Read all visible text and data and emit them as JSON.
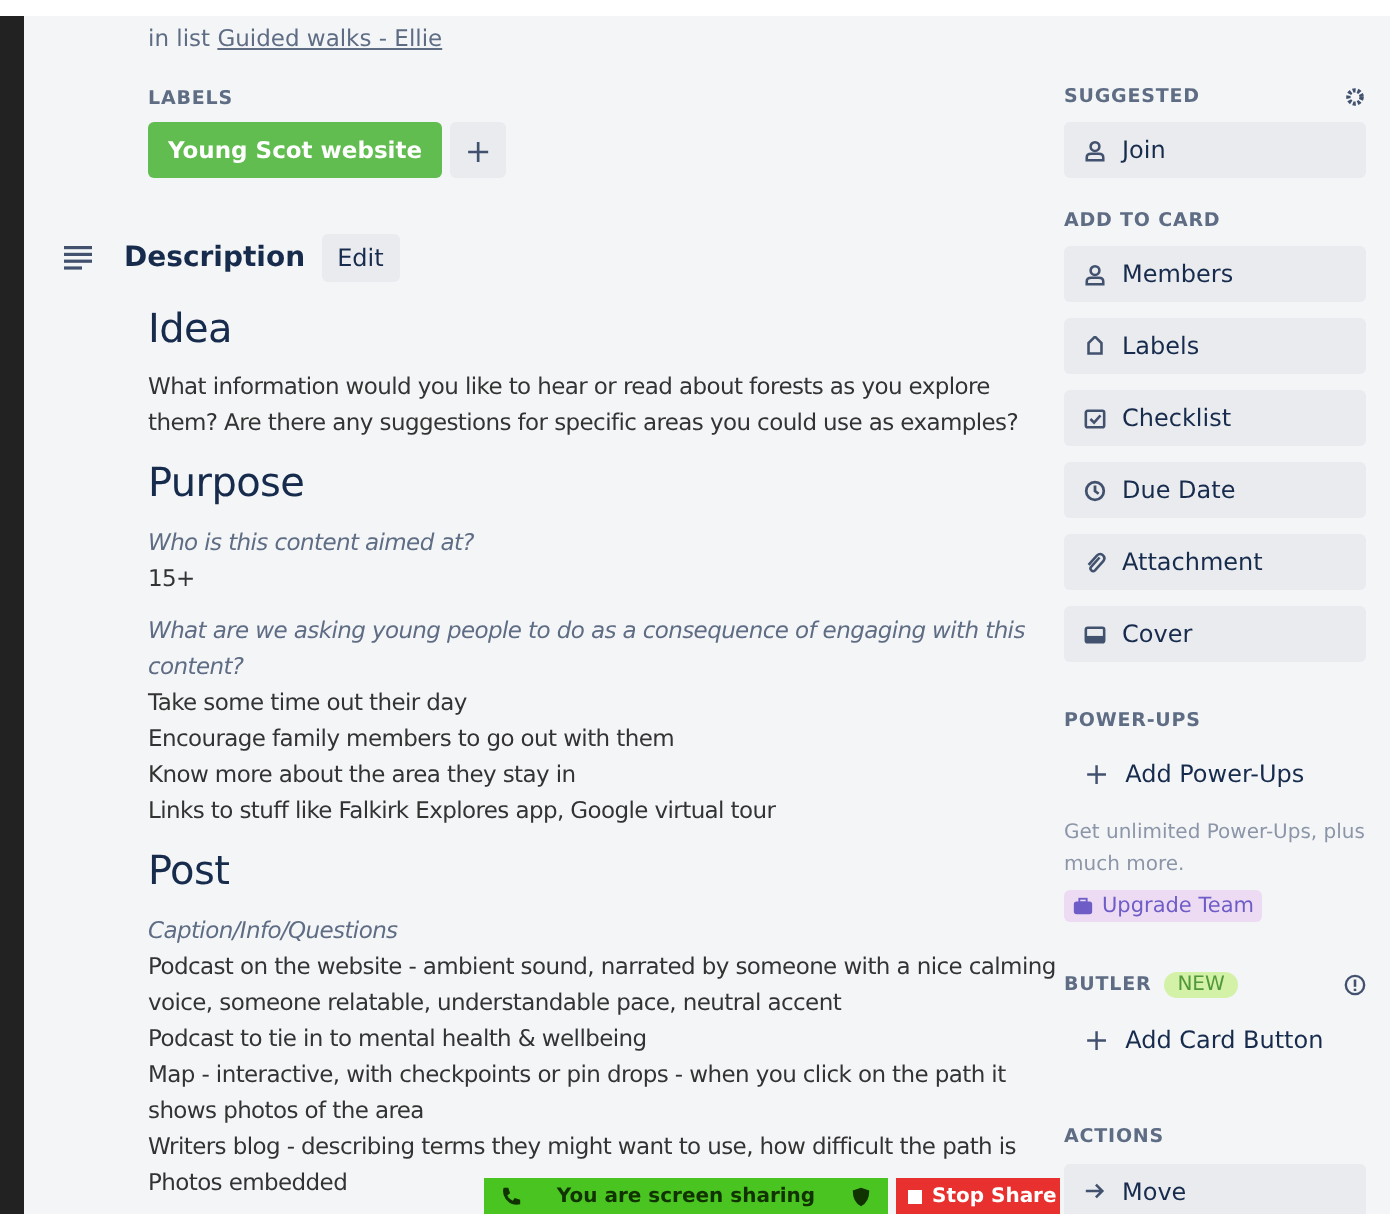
{
  "card": {
    "list_prefix": "in list",
    "list_name": "Guided walks - Ellie",
    "labels_heading": "LABELS",
    "labels": [
      {
        "text": "Young Scot website",
        "color": "#61bd4f"
      }
    ],
    "add_label": "+"
  },
  "description": {
    "title": "Description",
    "edit": "Edit",
    "blocks": [
      {
        "kind": "heading",
        "text": "Idea"
      },
      {
        "kind": "text",
        "text": "What information would you like to hear or read about forests as you explore them? Are there any suggestions for specific areas you could use as examples?"
      },
      {
        "kind": "heading",
        "text": "Purpose"
      },
      {
        "kind": "italic",
        "text": "Who is this content aimed at?"
      },
      {
        "kind": "line",
        "text": "15+"
      },
      {
        "kind": "italic",
        "text": "What are we asking young people to do as a consequence of engaging with this content?"
      },
      {
        "kind": "line",
        "text": "Take some time out their day"
      },
      {
        "kind": "line",
        "text": "Encourage family members to go out with them"
      },
      {
        "kind": "line",
        "text": "Know more about the area they stay in"
      },
      {
        "kind": "line",
        "text": "Links to stuff like Falkirk Explores app, Google virtual tour"
      },
      {
        "kind": "heading",
        "text": "Post"
      },
      {
        "kind": "italic",
        "text": "Caption/Info/Questions"
      },
      {
        "kind": "text",
        "text": "Podcast on the website - ambient sound, narrated by someone with a nice calming voice, someone relatable, understandable pace, neutral accent"
      },
      {
        "kind": "line",
        "text": "Podcast to tie in to mental health & wellbeing"
      },
      {
        "kind": "line",
        "text": "Map - interactive, with checkpoints or pin drops - when you click on the path it shows photos of the area"
      },
      {
        "kind": "line",
        "text": "Writers blog - describing terms they might want to use, how difficult the path is"
      },
      {
        "kind": "line",
        "text": "Photos embedded"
      }
    ]
  },
  "sidebar": {
    "suggested": {
      "heading": "SUGGESTED",
      "buttons": [
        {
          "kind": "person",
          "label": "Join"
        }
      ]
    },
    "add_to_card": {
      "heading": "ADD TO CARD",
      "buttons": [
        {
          "kind": "person",
          "label": "Members"
        },
        {
          "kind": "tag",
          "label": "Labels"
        },
        {
          "kind": "checklist",
          "label": "Checklist"
        },
        {
          "kind": "clock",
          "label": "Due Date"
        },
        {
          "kind": "clip",
          "label": "Attachment"
        },
        {
          "kind": "cover",
          "label": "Cover"
        }
      ]
    },
    "power_ups": {
      "heading": "POWER-UPS",
      "add": "Add Power-Ups",
      "plus": "+",
      "note": "Get unlimited Power-Ups, plus much more.",
      "upgrade": "Upgrade Team"
    },
    "butler": {
      "heading": "BUTLER",
      "badge": "NEW",
      "add": "Add Card Button",
      "plus": "+"
    },
    "actions": {
      "heading": "ACTIONS",
      "buttons": [
        {
          "kind": "arrow",
          "label": "Move"
        }
      ]
    }
  },
  "share_bar": {
    "message": "You are screen sharing",
    "stop": "Stop Share"
  }
}
